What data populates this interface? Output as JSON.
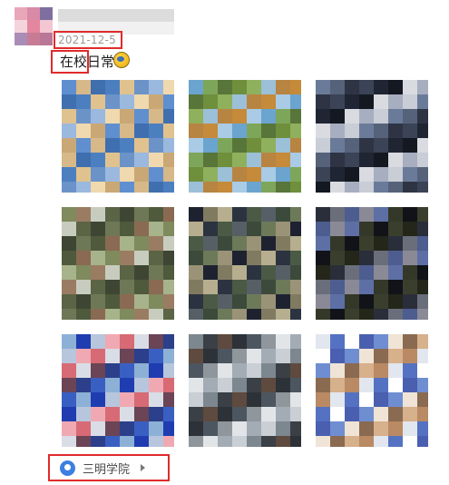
{
  "post": {
    "date": "2021-12-5",
    "text": "在校日常",
    "emoji_icon": "moon-face-icon",
    "location": "三明学院",
    "location_icon": "location-pin-icon",
    "photos_count": 9
  },
  "colors": {
    "highlight_box": "#e02b2b",
    "location_pin": "#3d7fe0",
    "date_text": "#9a9a9a"
  }
}
